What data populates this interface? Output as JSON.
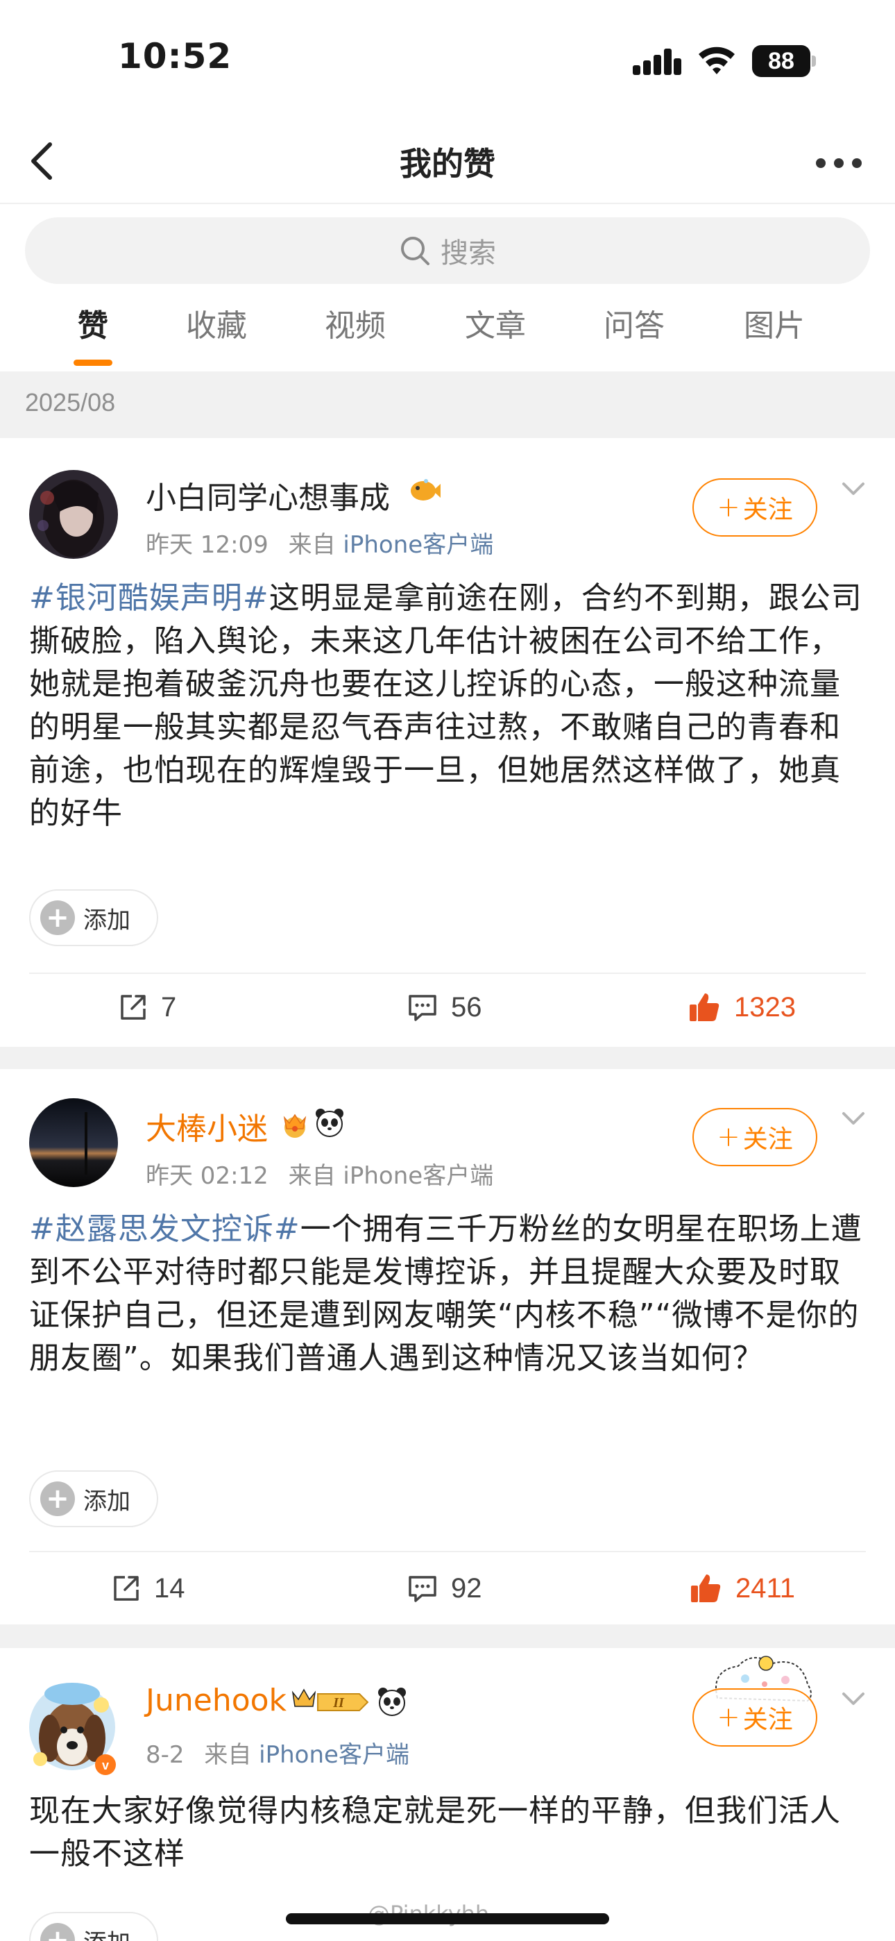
{
  "status_bar": {
    "time": "10:52",
    "battery": "88"
  },
  "nav": {
    "title": "我的赞"
  },
  "search": {
    "placeholder": "搜索"
  },
  "tabs": [
    "赞",
    "收藏",
    "视频",
    "文章",
    "问答",
    "图片"
  ],
  "active_tab": "赞",
  "date_group": "2025/08",
  "posts": [
    {
      "username": "小白同学心想事成",
      "time": "昨天 12:09",
      "source_prefix": "来自",
      "source": "iPhone客户端",
      "follow_label": "关注",
      "tag": "#银河酷娱声明#",
      "text": "这明显是拿前途在刚，合约不到期，跟公司撕破脸，陷入舆论，未来这几年估计被困在公司不给工作，她就是抱着破釜沉舟也要在这儿控诉的心态，一般这种流量的明星一般其实都是忍气吞声往过熬，不敢赌自己的青春和前途，也怕现在的辉煌毁于一旦，但她居然这样做了，她真的好牛",
      "add_label": "添加",
      "reposts": "7",
      "comments": "56",
      "likes": "1323"
    },
    {
      "username": "大棒小迷",
      "time": "昨天 02:12",
      "source_prefix": "来自",
      "source": "iPhone客户端",
      "follow_label": "关注",
      "tag": "#赵露思发文控诉#",
      "text": "一个拥有三千万粉丝的女明星在职场上遭到不公平对待时都只能是发博控诉，并且提醒大众要及时取证保护自己，但还是遭到网友嘲笑“内核不稳”“微博不是你的朋友圈”。如果我们普通人遇到这种情况又该当如何？",
      "add_label": "添加",
      "reposts": "14",
      "comments": "92",
      "likes": "2411"
    },
    {
      "username": "Junehook",
      "time": "8-2",
      "source_prefix": "来自",
      "source": "iPhone客户端",
      "follow_label": "关注",
      "tag": "",
      "text": "现在大家好像觉得内核稳定就是死一样的平静，但我们活人一般不这样",
      "add_label": "添加"
    }
  ],
  "watermark": "@Pinkkyhh",
  "colors": {
    "accent": "#ff8200",
    "topic": "#4f76a8",
    "like": "#e8531e"
  }
}
